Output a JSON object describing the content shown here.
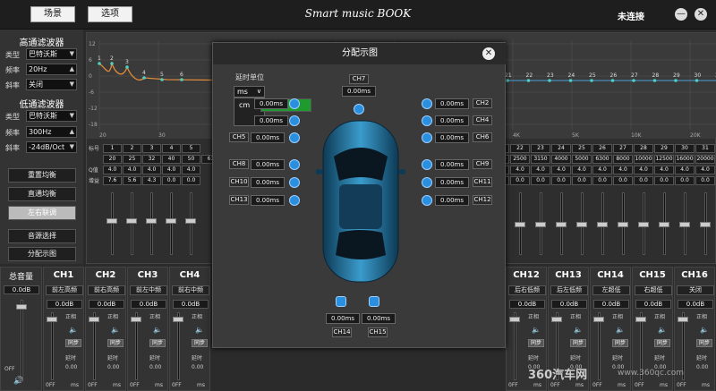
{
  "titlebar": {
    "scene_btn": "场景",
    "options_btn": "选项",
    "app_title": "Smart music BOOK",
    "connection": "未连接",
    "minimize": "—",
    "close": "✕"
  },
  "left": {
    "hp_title": "高通滤波器",
    "lp_title": "低通滤波器",
    "type_label": "类型",
    "freq_label": "频率",
    "slope_label": "斜率",
    "hp_type": "巴特沃斯",
    "hp_freq": "20Hz",
    "hp_slope": "关闭",
    "lp_type": "巴特沃斯",
    "lp_freq": "300Hz",
    "lp_slope": "-24dB/Oct",
    "btn_reset": "重置均衡",
    "btn_flat": "直通均衡",
    "btn_link": "左右联调",
    "btn_source": "音源选择",
    "btn_distribution": "分配示图"
  },
  "eq": {
    "axis_left": [
      "12",
      "6",
      "0",
      "-6",
      "-12",
      "-18"
    ],
    "freq_ticks": [
      "20",
      "30",
      "40",
      "50",
      "1K",
      "2K",
      "3K",
      "4K",
      "5K",
      "10K",
      "20K"
    ],
    "points_left": [
      "1",
      "2",
      "3",
      "4",
      "5",
      "6"
    ],
    "points_right": [
      "21",
      "22",
      "23",
      "24",
      "25",
      "26",
      "27",
      "28",
      "29",
      "30",
      "31"
    ],
    "row_label_band": "标号",
    "row_label_freq": "",
    "row_label_q": "Q值",
    "row_label_gain": "增益",
    "bands_left": [
      "1",
      "2",
      "3",
      "4",
      "5"
    ],
    "freq_left": [
      "20",
      "25",
      "32",
      "40",
      "50",
      "63"
    ],
    "q_left": [
      "4.0",
      "4.0",
      "4.0",
      "4.0",
      "4.0"
    ],
    "gain_left": [
      "7.6",
      "5.6",
      "4.3",
      "0.0",
      "0.0"
    ],
    "bands_right": [
      "21",
      "22",
      "23",
      "24",
      "25",
      "26",
      "27",
      "28",
      "29",
      "30",
      "31"
    ],
    "freq_right": [
      "2000",
      "2500",
      "3150",
      "4000",
      "5000",
      "6300",
      "8000",
      "10000",
      "12500",
      "16000",
      "20000"
    ],
    "q_right": [
      "4.0",
      "4.0",
      "4.0",
      "4.0",
      "4.0",
      "4.0",
      "4.0",
      "4.0",
      "4.0",
      "4.0",
      "4.0"
    ],
    "gain_right": [
      "0.0",
      "0.0",
      "0.0",
      "0.0",
      "0.0",
      "0.0",
      "0.0",
      "0.0",
      "0.0",
      "0.0",
      "0.0"
    ]
  },
  "master": {
    "label": "总音量",
    "db": "0.0dB",
    "off": "OFF",
    "ticks": [
      "0",
      "-10",
      "-20",
      "-30",
      "-40",
      "-50"
    ]
  },
  "channels": [
    {
      "name": "CH1",
      "role": "前左高频",
      "db": "0.0dB"
    },
    {
      "name": "CH2",
      "role": "前右高频",
      "db": "0.0dB"
    },
    {
      "name": "CH3",
      "role": "前左中频",
      "db": "0.0dB"
    },
    {
      "name": "CH4",
      "role": "前右中频",
      "db": "0.0dB"
    },
    {
      "name": "CH12",
      "role": "后右低频",
      "db": "0.0dB"
    },
    {
      "name": "CH13",
      "role": "后左低频",
      "db": "0.0dB"
    },
    {
      "name": "CH14",
      "role": "左超低",
      "db": "0.0dB"
    },
    {
      "name": "CH15",
      "role": "右超低",
      "db": "0.0dB"
    },
    {
      "name": "CH16",
      "role": "关闭",
      "db": "0.0dB"
    }
  ],
  "ch_controls": {
    "phase": "正相",
    "sync": "同步",
    "delay": "延时",
    "value": "0.00",
    "unit": "ms",
    "off": "0FF"
  },
  "dialog": {
    "title": "分配示图",
    "unit_label": "延时单位",
    "unit_selected": "ms",
    "unit_options": [
      "ms",
      "cm"
    ],
    "ch7": "CH7",
    "ch7_val": "0.00ms",
    "left_rows": [
      {
        "ch": "CH5",
        "val": "0.00ms"
      },
      {
        "ch": "CH8",
        "val": "0.00ms"
      },
      {
        "ch": "CH10",
        "val": "0.00ms"
      },
      {
        "ch": "CH13",
        "val": "0.00ms"
      }
    ],
    "left_hidden_vals": [
      "0.00ms",
      "0.00ms"
    ],
    "right_rows": [
      {
        "ch": "CH2",
        "val": "0.00ms"
      },
      {
        "ch": "CH4",
        "val": "0.00ms"
      },
      {
        "ch": "CH6",
        "val": "0.00ms"
      },
      {
        "ch": "CH9",
        "val": "0.00ms"
      },
      {
        "ch": "CH11",
        "val": "0.00ms"
      },
      {
        "ch": "CH12",
        "val": "0.00ms"
      }
    ],
    "ch14": "CH14",
    "ch14_val": "0.00ms",
    "ch15": "CH15",
    "ch15_val": "0.00ms"
  },
  "watermark": {
    "brand": "360汽车网",
    "url": "www.360qc.com"
  }
}
